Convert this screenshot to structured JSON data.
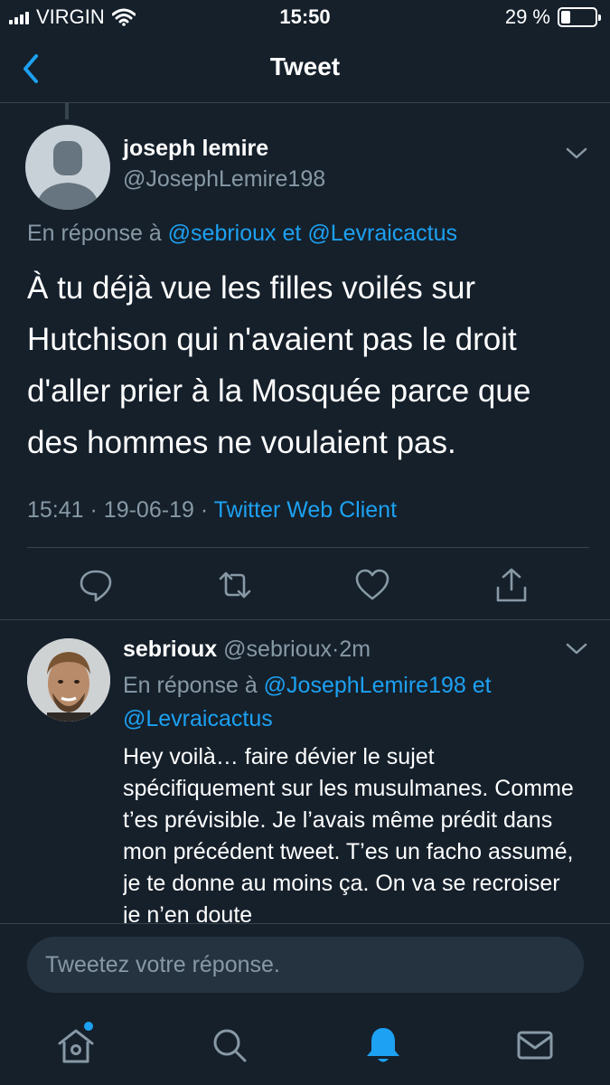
{
  "status_bar": {
    "carrier": "VIRGIN",
    "time": "15:50",
    "battery": "29 %",
    "battery_level": 0.29
  },
  "nav": {
    "title": "Tweet",
    "back_icon": "chevron-left-icon"
  },
  "main_tweet": {
    "name": "joseph lemire",
    "handle": "@JosephLemire198",
    "reply_prefix": "En réponse à",
    "reply_user1": "@sebrioux",
    "reply_and": "et",
    "reply_user2": "@Levraicactus",
    "text": "À tu déjà vue les filles voilés sur Hutchison qui n'avaient pas le droit d'aller prier à la Mosquée parce que des hommes ne voulaient pas.",
    "time": "15:41",
    "date": "19-06-19",
    "sep": "·",
    "client": "Twitter Web Client"
  },
  "reply_tweet": {
    "name": "sebrioux",
    "handle": "@sebrioux",
    "sep": "·",
    "age": "2m",
    "reply_prefix": "En réponse à",
    "reply_user1": "@JosephLemire198",
    "reply_and": "et",
    "reply_user2": "@Levraicactus",
    "text": "Hey voilà… faire dévier le sujet spécifiquement sur les musulmanes. Comme t’es prévisible. Je l’avais même prédit dans mon précédent tweet. T’es un facho assumé, je te donne au moins ça. On va se recroiser je n’en doute"
  },
  "compose": {
    "placeholder": "Tweetez votre réponse."
  },
  "colors": {
    "background": "#15202b",
    "accent": "#1da1f2",
    "muted": "#8899a6",
    "divider": "#38444d"
  }
}
